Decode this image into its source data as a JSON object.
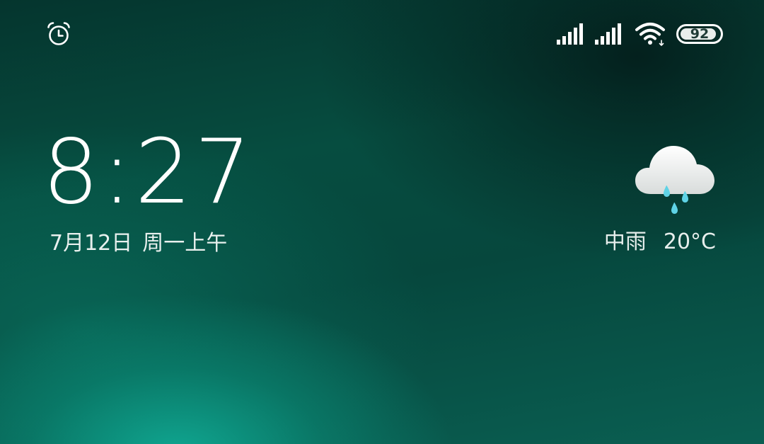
{
  "status_bar": {
    "left_icons": [
      "alarm-clock-icon"
    ],
    "right_icons": [
      "cellular-signal-icon",
      "cellular-signal-icon",
      "wifi-icon",
      "battery-icon"
    ],
    "battery_level": "92"
  },
  "clock": {
    "time": "8:27",
    "date": "7月12日",
    "weekday_period": "周一上午"
  },
  "weather": {
    "icon": "cloud-rain-icon",
    "condition": "中雨",
    "temperature": "20°C"
  },
  "colors": {
    "background_dark": "#05352e",
    "background_teal": "#10aa94",
    "text": "#ffffff",
    "rain_drop": "#5fd3e6"
  }
}
